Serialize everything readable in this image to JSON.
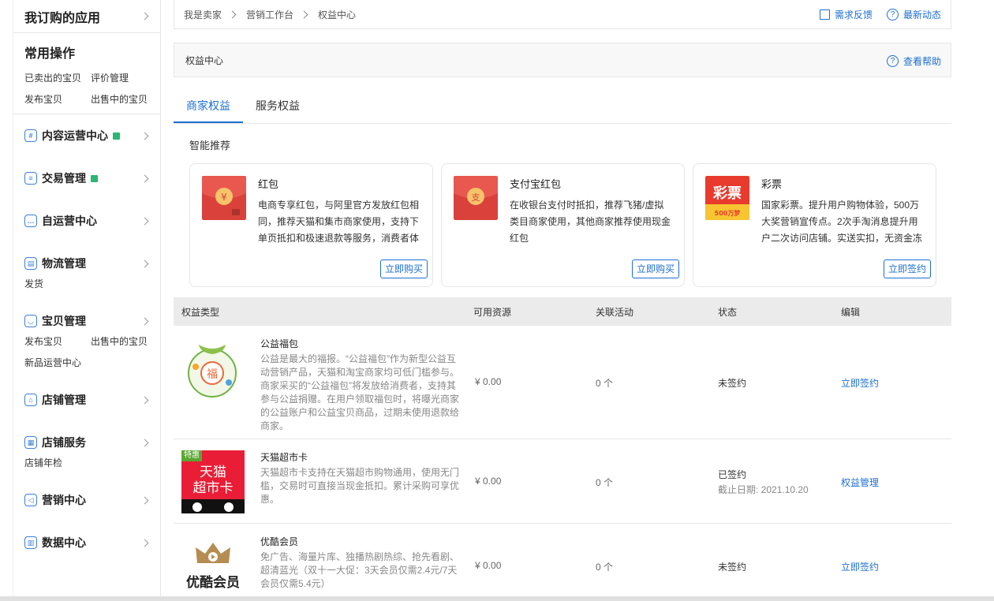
{
  "sidebar": {
    "subscribed_apps": "我订购的应用",
    "common_ops_title": "常用操作",
    "common_ops": [
      "已卖出的宝贝",
      "评价管理",
      "发布宝贝",
      "出售中的宝贝"
    ],
    "sections": [
      {
        "label": "内容运营中心",
        "icon": "hash-icon",
        "flag": true,
        "subs": []
      },
      {
        "label": "交易管理",
        "icon": "clipboard-icon",
        "flag": true,
        "subs": []
      },
      {
        "label": "自运营中心",
        "icon": "chat-icon",
        "flag": false,
        "subs": []
      },
      {
        "label": "物流管理",
        "icon": "truck-icon",
        "flag": false,
        "subs": [
          "发货"
        ]
      },
      {
        "label": "宝贝管理",
        "icon": "bag-icon",
        "flag": false,
        "subs": [
          "发布宝贝",
          "出售中的宝贝",
          "新品运营中心"
        ]
      },
      {
        "label": "店铺管理",
        "icon": "store-icon",
        "flag": false,
        "subs": []
      },
      {
        "label": "店铺服务",
        "icon": "grid-icon",
        "flag": false,
        "subs": [
          "店铺年检"
        ]
      },
      {
        "label": "营销中心",
        "icon": "megaphone-icon",
        "flag": false,
        "subs": []
      },
      {
        "label": "数据中心",
        "icon": "chart-icon",
        "flag": false,
        "subs": []
      }
    ]
  },
  "breadcrumb": [
    "我是卖家",
    "营销工作台",
    "权益中心"
  ],
  "header_links": {
    "feedback": "需求反馈",
    "news": "最新动态"
  },
  "title_bar": {
    "title": "权益中心",
    "help": "查看帮助"
  },
  "tabs": [
    "商家权益",
    "服务权益"
  ],
  "recommend": {
    "title": "智能推荐",
    "cards": [
      {
        "title": "红包",
        "desc": "电商专享红包，与阿里官方发放红包相同，推荐天猫和集市商家使用，支持下单页抵扣和极速退款等服务，消费者体",
        "button": "立即购买",
        "icon": "red-packet-icon"
      },
      {
        "title": "支付宝红包",
        "desc": "在收银台支付时抵扣，推荐飞猪/虚拟类目商家使用，其他商家推荐使用现金红包",
        "button": "立即购买",
        "icon": "alipay-packet-icon"
      },
      {
        "title": "彩票",
        "desc": "国家彩票。提升用户购物体验，500万大奖营销宣传点。2次手淘消息提升用户二次访问店铺。实送实扣，无资金冻结",
        "button": "立即签约",
        "icon": "lottery-icon"
      }
    ]
  },
  "table": {
    "headers": [
      "权益类型",
      "可用资源",
      "关联活动",
      "状态",
      "编辑"
    ],
    "rows": [
      {
        "name": "公益福包",
        "desc": "公益是最大的福报。“公益福包”作为新型公益互动营销产品，天猫和淘宝商家均可低门槛参与。商家采买的“公益福包”将发放给消费者，支持其参与公益捐赠。在用户领取福包时，将曝光商家的公益账户和公益宝贝商品，过期未使用退款给商家。",
        "resource": "¥ 0.00",
        "activity": "0 个",
        "status": "未签约",
        "status_sub": "",
        "action": "立即签约",
        "thumb": "fortune-bag-icon"
      },
      {
        "name": "天猫超市卡",
        "desc": "天猫超市卡支持在天猫超市购物通用，使用无门槛，交易时可直接当现金抵扣。累计采购可享优惠。",
        "resource": "¥ 0.00",
        "activity": "0 个",
        "status": "已签约",
        "status_sub": "截止日期: 2021.10.20",
        "action": "权益管理",
        "thumb": "tmall-card-icon",
        "badge": "特惠",
        "card_text": [
          "天猫",
          "超市卡"
        ]
      },
      {
        "name": "优酷会员",
        "desc": "免广告、海量片库、独播热剧热综、抢先看剧、超清蓝光（双十一大促：3天会员仅需2.4元/7天会员仅需5.4元）",
        "resource": "¥ 0.00",
        "activity": "0 个",
        "status": "未签约",
        "status_sub": "",
        "action": "立即签约",
        "thumb": "youku-vip-icon",
        "thumb_text": "优酷会员"
      }
    ]
  },
  "colors": {
    "accent": "#1e6fd0",
    "red": "#e64340"
  }
}
